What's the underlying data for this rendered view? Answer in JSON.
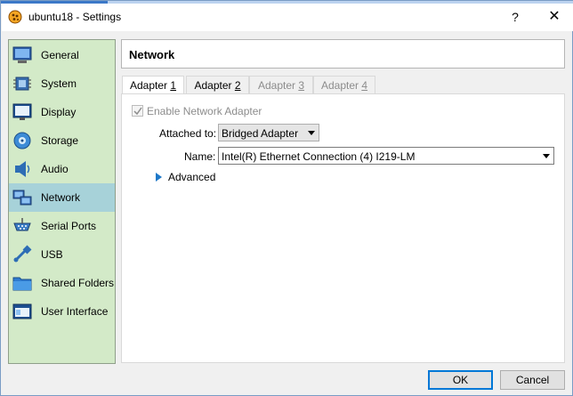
{
  "window": {
    "title": "ubuntu18 - Settings"
  },
  "titlebar": {
    "help_label": "?",
    "close_label": "✕"
  },
  "sidebar": {
    "items": [
      {
        "label": "General",
        "icon": "general-icon"
      },
      {
        "label": "System",
        "icon": "system-icon"
      },
      {
        "label": "Display",
        "icon": "display-icon"
      },
      {
        "label": "Storage",
        "icon": "storage-icon"
      },
      {
        "label": "Audio",
        "icon": "audio-icon"
      },
      {
        "label": "Network",
        "icon": "network-icon",
        "selected": true
      },
      {
        "label": "Serial Ports",
        "icon": "serial-ports-icon"
      },
      {
        "label": "USB",
        "icon": "usb-icon"
      },
      {
        "label": "Shared Folders",
        "icon": "shared-folders-icon"
      },
      {
        "label": "User Interface",
        "icon": "user-interface-icon"
      }
    ]
  },
  "header": {
    "title": "Network"
  },
  "tabs": [
    {
      "label": "Adapter ",
      "accel": "1",
      "state": "active"
    },
    {
      "label": "Adapter ",
      "accel": "2",
      "state": "enabled"
    },
    {
      "label": "Adapter ",
      "accel": "3",
      "state": "disabled"
    },
    {
      "label": "Adapter ",
      "accel": "4",
      "state": "disabled"
    }
  ],
  "adapter": {
    "enable_label": "Enable Network Adapter",
    "enabled": true,
    "attached_label": "Attached to:",
    "attached_value": "Bridged Adapter",
    "name_label": "Name:",
    "name_value": "Intel(R) Ethernet Connection (4) I219-LM",
    "advanced_label": "Advanced"
  },
  "buttons": {
    "ok_label": "OK",
    "cancel_label": "Cancel"
  },
  "colors": {
    "sidebar_bg": "#d3eac8",
    "sidebar_selected": "#a7d2d9",
    "accent": "#0078d7"
  }
}
